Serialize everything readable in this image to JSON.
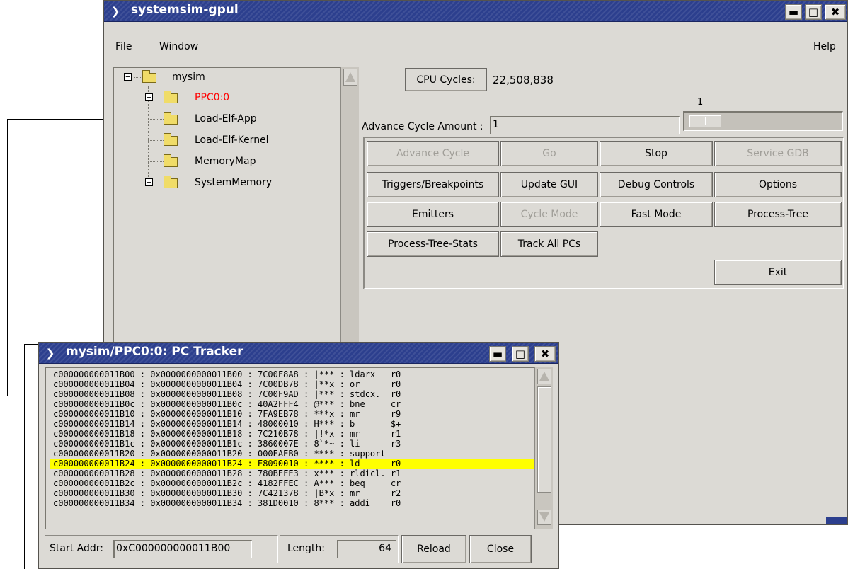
{
  "main_window": {
    "title": "systemsim-gpul",
    "menu": {
      "file": "File",
      "window": "Window",
      "help": "Help"
    },
    "tree": {
      "root": "mysim",
      "children": [
        "PPC0:0",
        "Load-Elf-App",
        "Load-Elf-Kernel",
        "MemoryMap",
        "SystemMemory"
      ]
    },
    "cpu_cycles_label": "CPU Cycles:",
    "cpu_cycles_value": "22,508,838",
    "slider_value": "1",
    "advance_label": "Advance Cycle Amount :",
    "advance_value": "1",
    "buttons": {
      "advance_cycle": "Advance Cycle",
      "go": "Go",
      "stop": "Stop",
      "service_gdb": "Service GDB",
      "triggers": "Triggers/Breakpoints",
      "update_gui": "Update GUI",
      "debug_controls": "Debug Controls",
      "options": "Options",
      "emitters": "Emitters",
      "cycle_mode": "Cycle Mode",
      "fast_mode": "Fast Mode",
      "process_tree": "Process-Tree",
      "process_tree_stats": "Process-Tree-Stats",
      "track_all_pcs": "Track All PCs",
      "exit": "Exit"
    },
    "colors": {
      "titlebar": "#2c3f8e",
      "window_bg": "#dcdad5",
      "highlight": "#ffff00",
      "tree_selected_text": "#ff0000"
    }
  },
  "tracker_window": {
    "title": "mysim/PPC0:0: PC Tracker",
    "rows": [
      "c000000000011B00 : 0x0000000000011B00 : 7C00F8A8 : |*** : ldarx   r0",
      "c000000000011B04 : 0x0000000000011B04 : 7C00DB78 : |**x : or      r0",
      "c000000000011B08 : 0x0000000000011B08 : 7C00F9AD : |*** : stdcx.  r0",
      "c000000000011B0c : 0x0000000000011B0c : 40A2FFF4 : @*** : bne     cr",
      "c000000000011B10 : 0x0000000000011B10 : 7FA9EB78 : ***x : mr      r9",
      "c000000000011B14 : 0x0000000000011B14 : 48000010 : H*** : b       $+",
      "c000000000011B18 : 0x0000000000011B18 : 7C210B78 : |!*x : mr      r1",
      "c000000000011B1c : 0x0000000000011B1c : 3860007E : 8`*~ : li      r3",
      "c000000000011B20 : 0x0000000000011B20 : 000EAEB0 : **** : support",
      "c000000000011B24 : 0x0000000000011B24 : E8090010 : **** : ld      r0",
      "c000000000011B28 : 0x0000000000011B28 : 780BEFE3 : x*** : rldicl. r1",
      "c000000000011B2c : 0x0000000000011B2c : 4182FFEC : A*** : beq     cr",
      "c000000000011B30 : 0x0000000000011B30 : 7C421378 : |B*x : mr      r2",
      "c000000000011B34 : 0x0000000000011B34 : 381D0010 : 8*** : addi    r0"
    ],
    "highlighted_row": 9,
    "start_addr_label": "Start Addr:",
    "start_addr_value": "0xC000000000011B00",
    "length_label": "Length:",
    "length_value": "64",
    "reload": "Reload",
    "close": "Close"
  }
}
